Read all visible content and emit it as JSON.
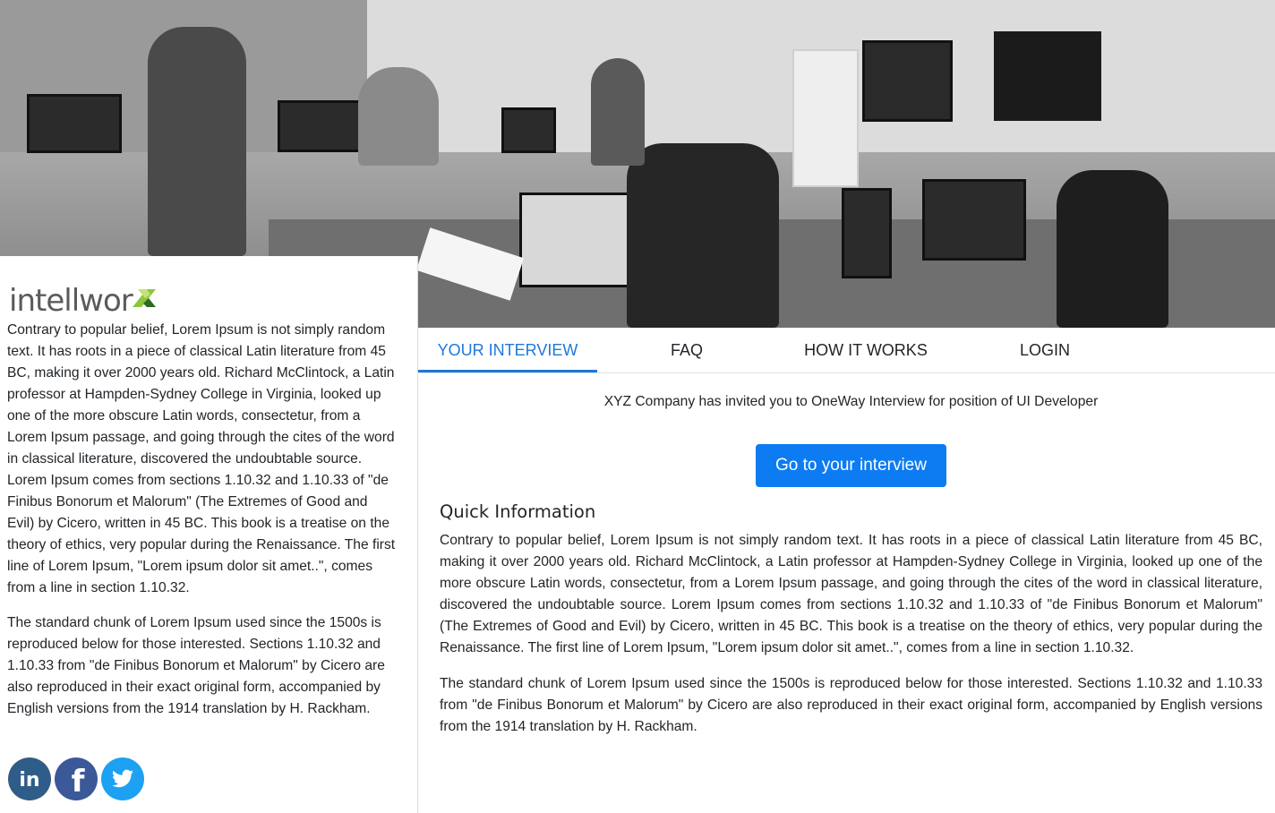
{
  "hero": {
    "alt": "office-photo"
  },
  "brand": {
    "name": "intellwor",
    "accent_green": "#8cc63f",
    "accent_dark": "#2e6b1f"
  },
  "left": {
    "paragraphs": [
      "Contrary to popular belief, Lorem Ipsum is not simply random text. It has roots in a piece of classical Latin literature from 45 BC, making it over 2000 years old. Richard McClintock, a Latin professor at Hampden-Sydney College in Virginia, looked up one of the more obscure Latin words, consectetur, from a Lorem Ipsum passage, and going through the cites of the word in classical literature, discovered the undoubtable source. Lorem Ipsum comes from sections 1.10.32 and 1.10.33 of \"de Finibus Bonorum et Malorum\" (The Extremes of Good and Evil) by Cicero, written in 45 BC. This book is a treatise on the theory of ethics, very popular during the Renaissance. The first line of Lorem Ipsum, \"Lorem ipsum dolor sit amet..\", comes from a line in section 1.10.32.",
      "The standard chunk of Lorem Ipsum used since the 1500s is reproduced below for those interested. Sections 1.10.32 and 1.10.33 from \"de Finibus Bonorum et Malorum\" by Cicero are also reproduced in their exact original form, accompanied by English versions from the 1914 translation by H. Rackham."
    ],
    "social": [
      {
        "icon": "linkedin-icon",
        "label": "in",
        "color": "#0e76a8"
      },
      {
        "icon": "facebook-icon",
        "label": "f",
        "color": "#3b5998"
      },
      {
        "icon": "twitter-icon",
        "label": "",
        "color": "#1da1f2"
      }
    ]
  },
  "nav": {
    "tabs": [
      {
        "label": "YOUR INTERVIEW",
        "active": true
      },
      {
        "label": "FAQ",
        "active": false
      },
      {
        "label": "HOW IT WORKS",
        "active": false
      },
      {
        "label": "LOGIN",
        "active": false
      }
    ],
    "accent": "#1e78d8"
  },
  "main": {
    "invite_text": "XYZ Company has invited you to OneWay Interview for position of UI Developer",
    "go_button": "Go to your interview",
    "button_color": "#0d7cf2",
    "quick_info_title": "Quick Information",
    "paragraphs": [
      "Contrary to popular belief, Lorem Ipsum is not simply random text. It has roots in a piece of classical Latin literature from 45 BC, making it over 2000 years old. Richard McClintock, a Latin professor at Hampden-Sydney College in Virginia, looked up one of the more obscure Latin words, consectetur, from a Lorem Ipsum passage, and going through the cites of the word in classical literature, discovered the undoubtable source. Lorem Ipsum comes from sections 1.10.32 and 1.10.33 of \"de Finibus Bonorum et Malorum\" (The Extremes of Good and Evil) by Cicero, written in 45 BC. This book is a treatise on the theory of ethics, very popular during the Renaissance. The first line of Lorem Ipsum, \"Lorem ipsum dolor sit amet..\", comes from a line in section 1.10.32.",
      "The standard chunk of Lorem Ipsum used since the 1500s is reproduced below for those interested. Sections 1.10.32 and 1.10.33 from \"de Finibus Bonorum et Malorum\" by Cicero are also reproduced in their exact original form, accompanied by English versions from the 1914 translation by H. Rackham."
    ]
  }
}
